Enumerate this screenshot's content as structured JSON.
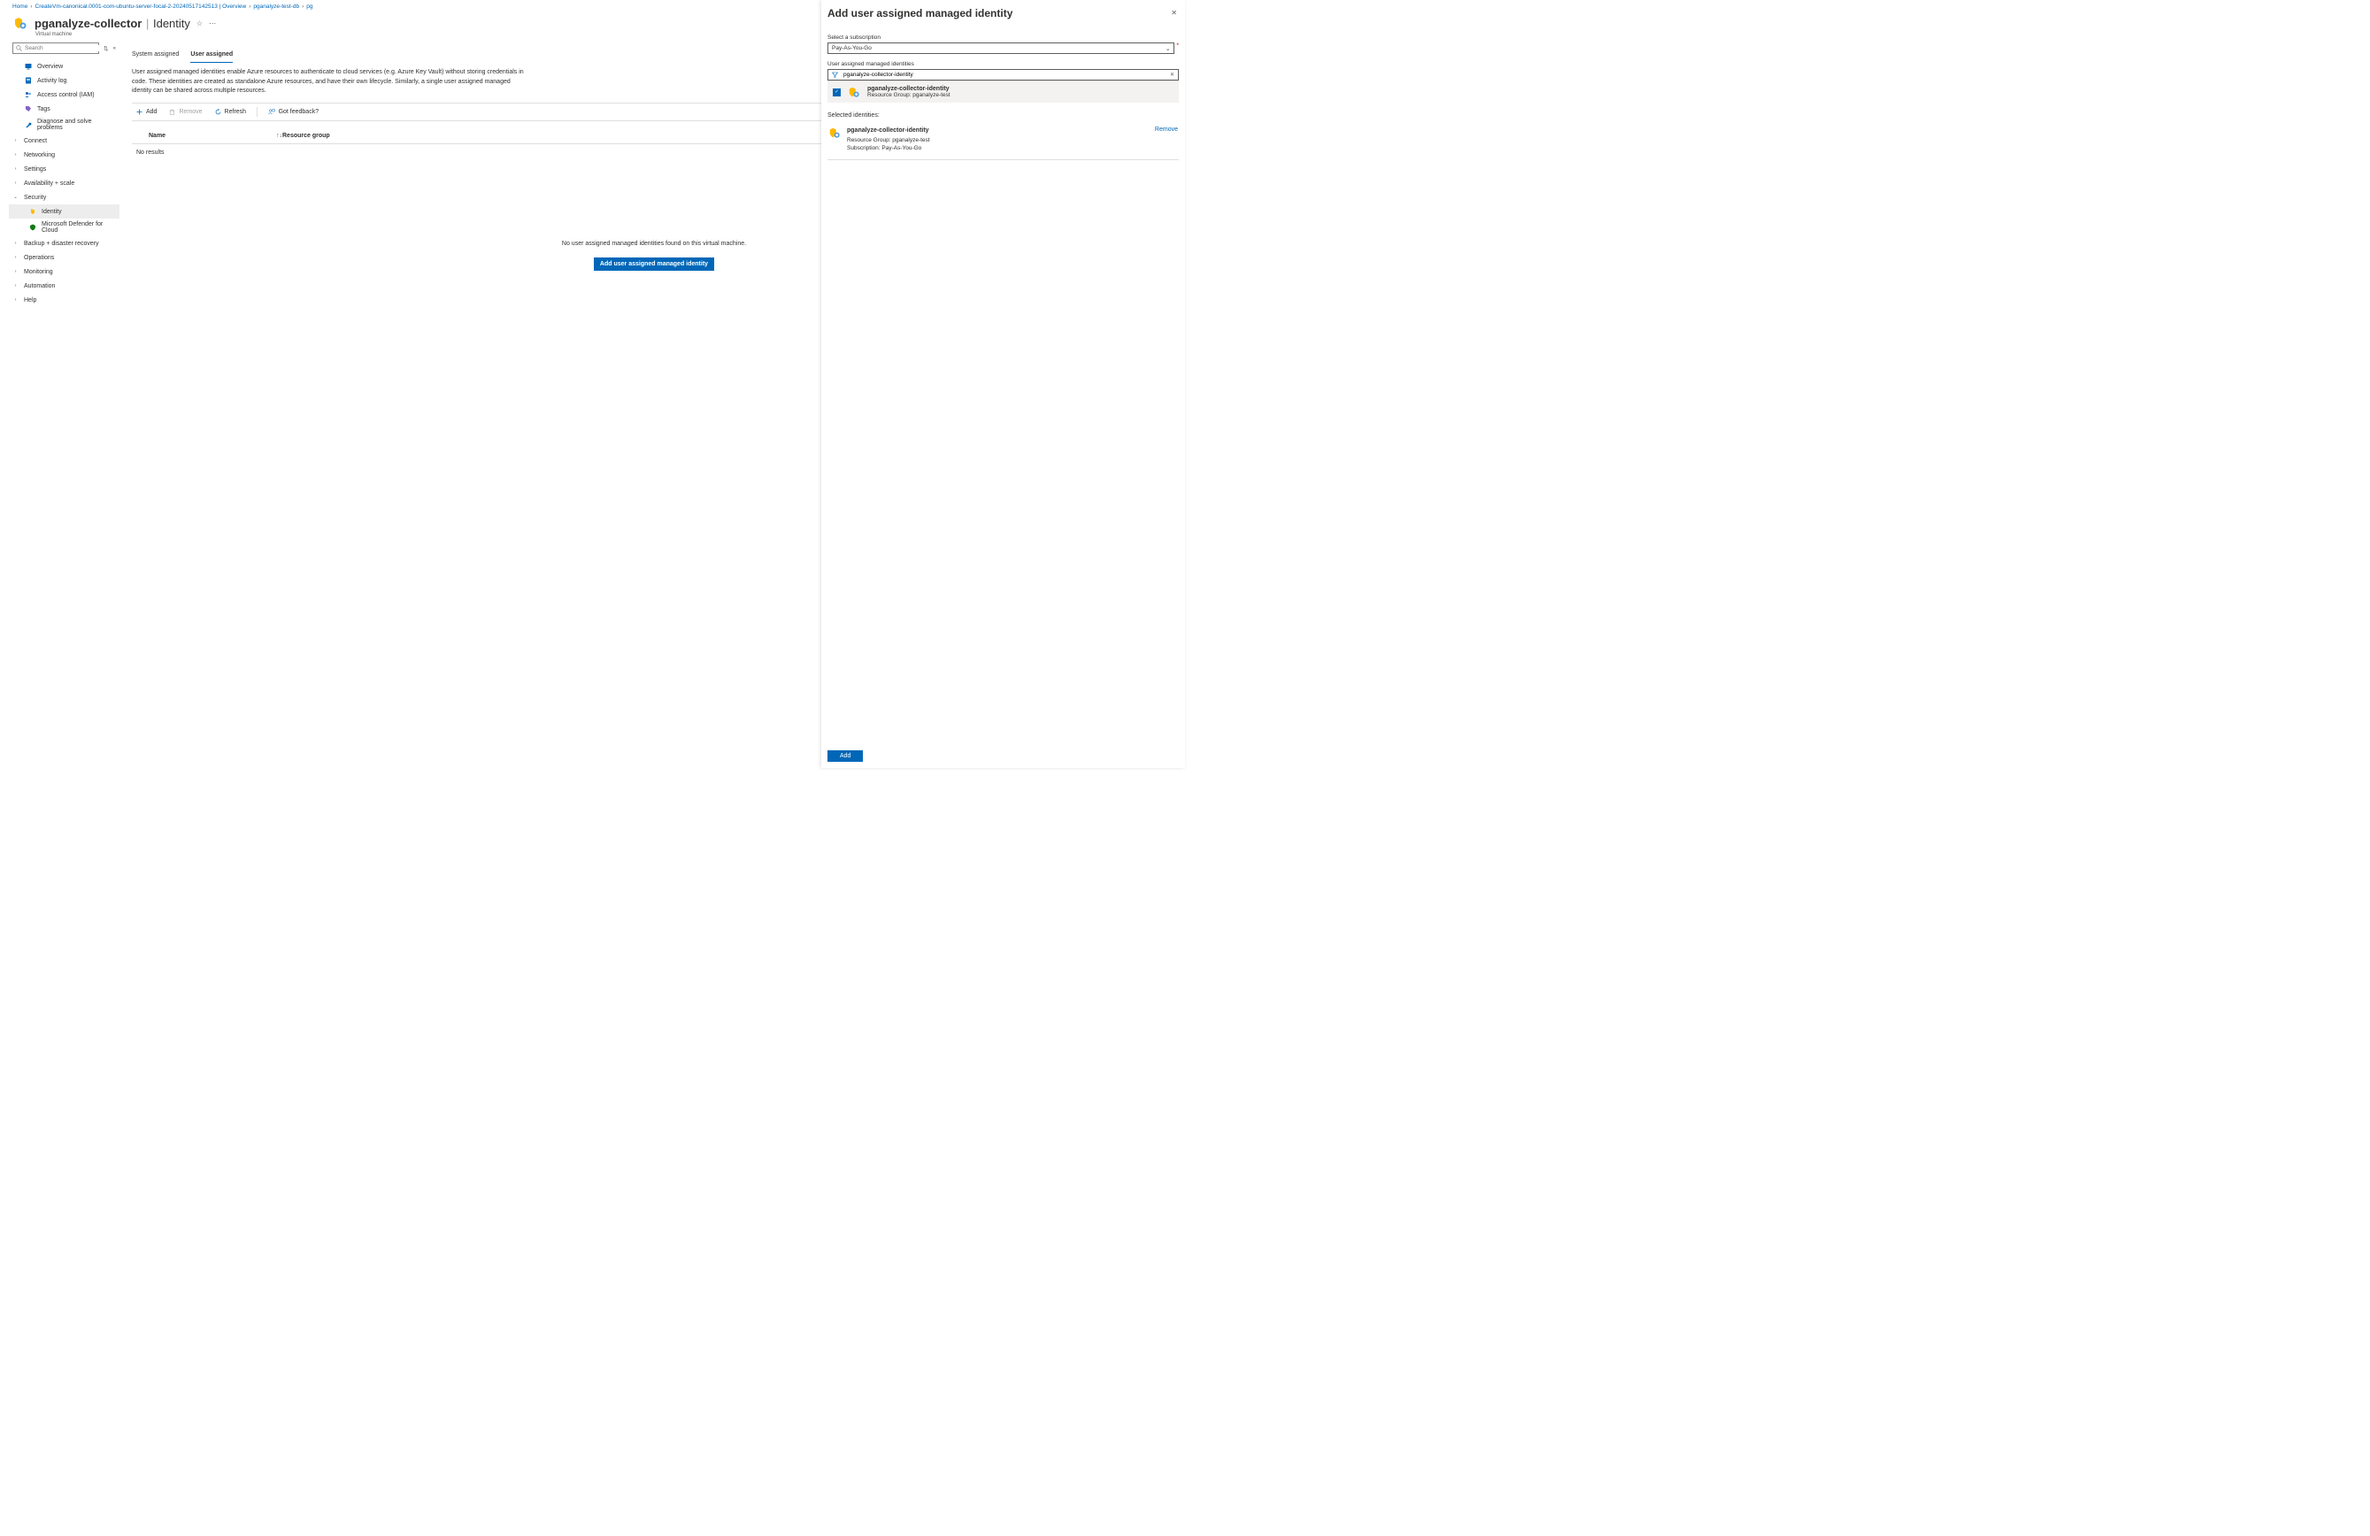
{
  "breadcrumb": {
    "home": "Home",
    "createvm": "CreateVm-canonical.0001-com-ubuntu-server-focal-2-20240517142513 | Overview",
    "db": "pganalyze-test-db",
    "truncated": "pg"
  },
  "header": {
    "resource": "pganalyze-collector",
    "section": "Identity",
    "subtitle": "Virtual machine"
  },
  "sidebar": {
    "search_placeholder": "Search",
    "items": {
      "overview": "Overview",
      "activity": "Activity log",
      "iam": "Access control (IAM)",
      "tags": "Tags",
      "diagnose": "Diagnose and solve problems",
      "connect": "Connect",
      "networking": "Networking",
      "settings": "Settings",
      "availability": "Availability + scale",
      "security": "Security",
      "identity": "Identity",
      "defender": "Microsoft Defender for Cloud",
      "backup": "Backup + disaster recovery",
      "operations": "Operations",
      "monitoring": "Monitoring",
      "automation": "Automation",
      "help": "Help"
    }
  },
  "tabs": {
    "system": "System assigned",
    "user": "User assigned"
  },
  "description": "User assigned managed identities enable Azure resources to authenticate to cloud services (e.g. Azure Key Vault) without storing credentials in code. These identities are created as standalone Azure resources, and have their own lifecycle. Similarly, a single user assigned managed identity can be shared across multiple resources.",
  "toolbar": {
    "add": "Add",
    "remove": "Remove",
    "refresh": "Refresh",
    "feedback": "Got feedback?"
  },
  "table": {
    "col_name": "Name",
    "col_rg": "Resource group",
    "no_results": "No results"
  },
  "empty": {
    "msg": "No user assigned managed identities found on this virtual machine.",
    "btn": "Add user assigned managed identity"
  },
  "panel": {
    "title": "Add user assigned managed identity",
    "sub_label": "Select a subscription",
    "sub_value": "Pay-As-You-Go",
    "uami_label": "User assigned managed identities",
    "filter_value": "pganalyze-collector-identity",
    "result": {
      "name": "pganalyze-collector-identity",
      "rg": "Resource Group: pganalyze-test"
    },
    "selected_header": "Selected identities:",
    "selected": {
      "name": "pganalyze-collector-identity",
      "rg": "Resource Group: pganalyze-test",
      "sub": "Subscription: Pay-As-You-Go"
    },
    "remove": "Remove",
    "add_btn": "Add"
  }
}
